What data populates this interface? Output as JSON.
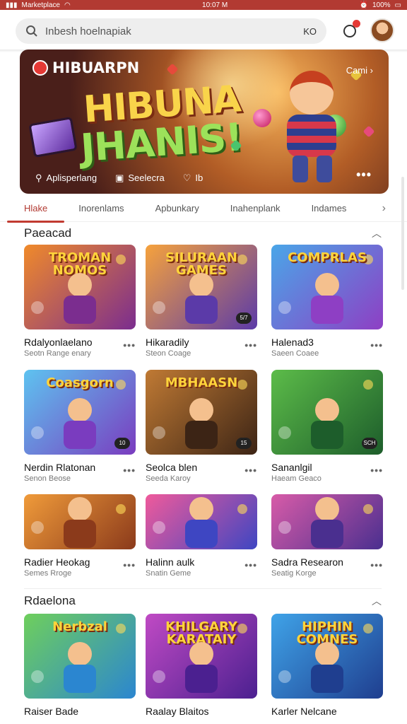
{
  "status": {
    "left": "Marketplace",
    "time": "10:07 M",
    "right": "100%"
  },
  "search": {
    "query": "Inbesh hoelnapiak",
    "kb_hint": "KO"
  },
  "hero": {
    "brand": "HIBUARPN",
    "title_line1": "HIBUNA",
    "title_line2": "JHANIS!",
    "top_right": "Cami",
    "actions": [
      {
        "icon": "game-controller-icon",
        "label": "Aplisperlang"
      },
      {
        "icon": "screen-icon",
        "label": "Seelecra"
      },
      {
        "icon": "heart-icon",
        "label": "Ib"
      }
    ]
  },
  "tabs": [
    "Hlake",
    "Inorenlams",
    "Apbunkary",
    "Inahenplank",
    "Indames"
  ],
  "sections": [
    {
      "title": "Paeacad",
      "cards": [
        {
          "name": "Rdalyonlaelano",
          "sub": "Seotn Range enary",
          "art": "TROMAN NOMOS",
          "c1": "#f08a2a",
          "c2": "#7b2d8f",
          "badge": ""
        },
        {
          "name": "Hikaradily",
          "sub": "Steon Coage",
          "art": "SILURAAN GAMES",
          "c1": "#f6a23c",
          "c2": "#5b3aa8",
          "badge": "5/7"
        },
        {
          "name": "Halenad3",
          "sub": "Saeen Coaee",
          "art": "COMPRLAS",
          "c1": "#4aa6e8",
          "c2": "#8e3fc4",
          "badge": ""
        },
        {
          "name": "Nerdin Rlatonan",
          "sub": "Senon Beose",
          "art": "Coasgorn",
          "c1": "#5ec3f0",
          "c2": "#7a3cbf",
          "badge": "10"
        },
        {
          "name": "Seolca blen",
          "sub": "Seeda Karoy",
          "art": "MBHAASN",
          "c1": "#c07a34",
          "c2": "#3c2415",
          "badge": "15"
        },
        {
          "name": "Sananlgil",
          "sub": "Haeam Geaco",
          "art": "",
          "c1": "#5cbc49",
          "c2": "#1d5d2b",
          "badge": "SCH"
        },
        {
          "name": "Radier Heokag",
          "sub": "Semes Rroge",
          "art": "",
          "c1": "#f09b3a",
          "c2": "#8b3a1b",
          "badge": ""
        },
        {
          "name": "Halinn aulk",
          "sub": "Snatin Geme",
          "art": "",
          "c1": "#f05a9b",
          "c2": "#3e46c2",
          "badge": ""
        },
        {
          "name": "Sadra Researon",
          "sub": "Seatig Korge",
          "art": "",
          "c1": "#d85ba8",
          "c2": "#4a2f8f",
          "badge": ""
        }
      ]
    },
    {
      "title": "Rdaelona",
      "cards": [
        {
          "name": "Raiser Bade",
          "sub": "",
          "art": "Nerbzal",
          "c1": "#6fcf5c",
          "c2": "#2b86d0",
          "badge": ""
        },
        {
          "name": "Raalay Blaitos",
          "sub": "",
          "art": "KHILGARY KARATAIY",
          "c1": "#c04ac4",
          "c2": "#4b2090",
          "badge": ""
        },
        {
          "name": "Karler Nelcane",
          "sub": "",
          "art": "HIPHIN COMNES",
          "c1": "#3fa3e8",
          "c2": "#1f3e8f",
          "badge": ""
        }
      ]
    }
  ]
}
